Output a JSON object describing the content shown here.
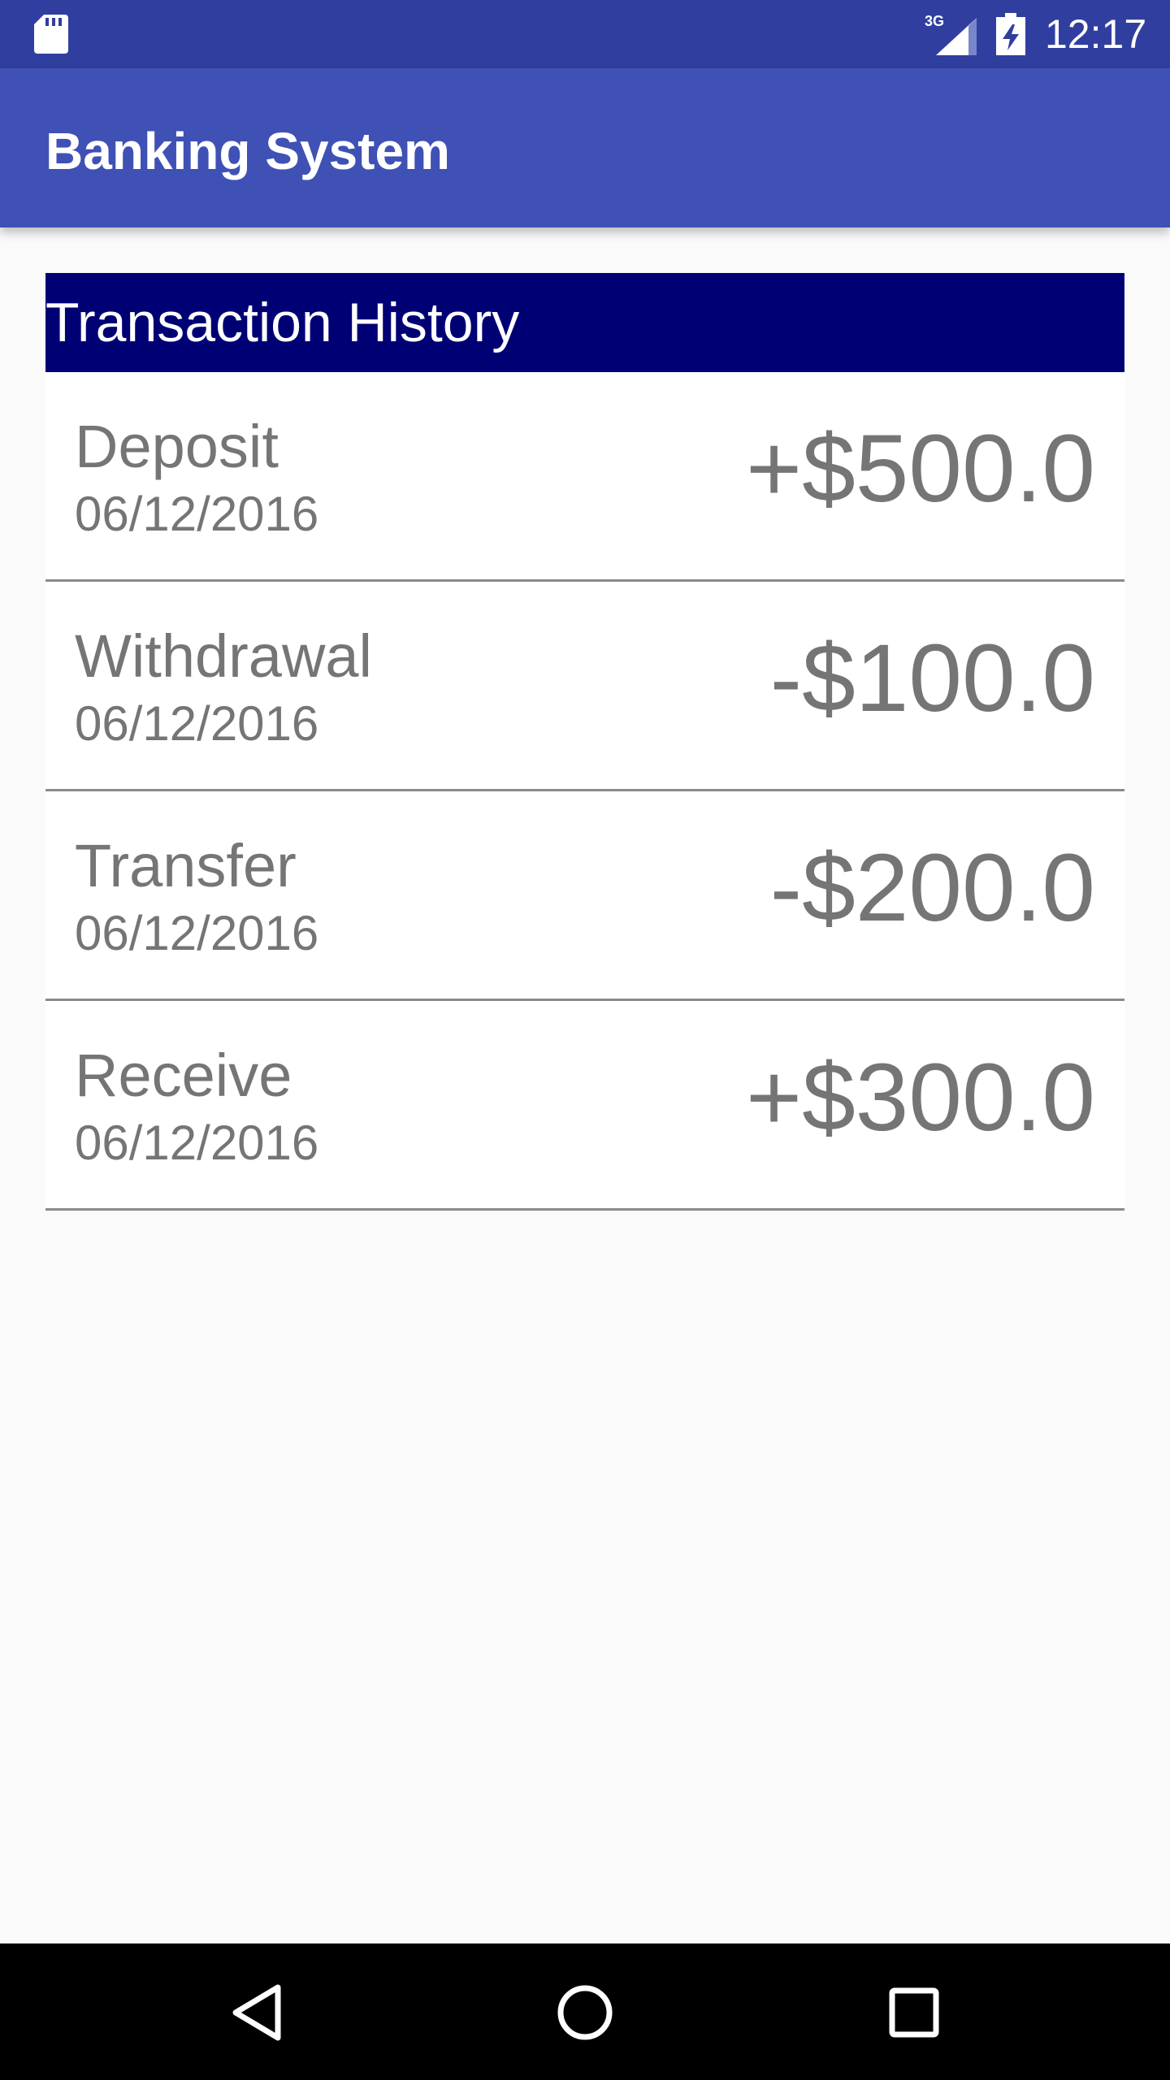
{
  "status_bar": {
    "time": "12:17",
    "network": "3G",
    "icons": [
      "sd-card-icon",
      "signal-icon",
      "battery-icon"
    ],
    "background": "#303F9F"
  },
  "app_bar": {
    "title": "Banking System",
    "background": "#3F51B5"
  },
  "history": {
    "header": "Transaction History",
    "header_background": "#000075",
    "transactions": [
      {
        "type": "Deposit",
        "date": "06/12/2016",
        "amount": "+$500.0"
      },
      {
        "type": "Withdrawal",
        "date": "06/12/2016",
        "amount": "-$100.0"
      },
      {
        "type": "Transfer",
        "date": "06/12/2016",
        "amount": "-$200.0"
      },
      {
        "type": "Receive",
        "date": "06/12/2016",
        "amount": "+$300.0"
      }
    ]
  },
  "nav_bar": {
    "buttons": [
      "back-icon",
      "home-icon",
      "recents-icon"
    ]
  }
}
